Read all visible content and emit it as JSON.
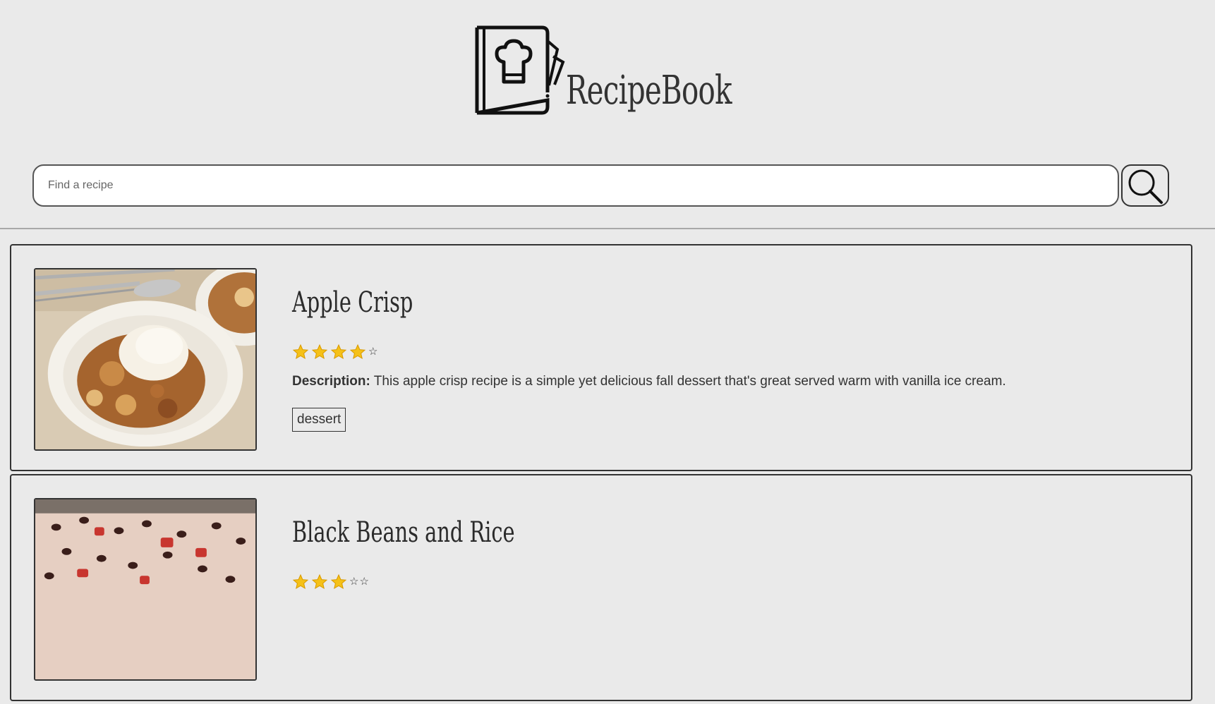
{
  "app": {
    "brand": "RecipeBook"
  },
  "search": {
    "placeholder": "Find a recipe",
    "value": "",
    "button_icon": "magnifier-icon"
  },
  "recipes": [
    {
      "title": "Apple Crisp",
      "rating": 4,
      "rating_max": 5,
      "description_label": "Description:",
      "description": "This apple crisp recipe is a simple yet delicious fall dessert that's great served warm with vanilla ice cream.",
      "tag": "dessert",
      "image": "apple-crisp-photo"
    },
    {
      "title": "Black Beans and Rice",
      "rating": 3,
      "rating_max": 5,
      "image": "black-beans-rice-photo"
    }
  ]
}
